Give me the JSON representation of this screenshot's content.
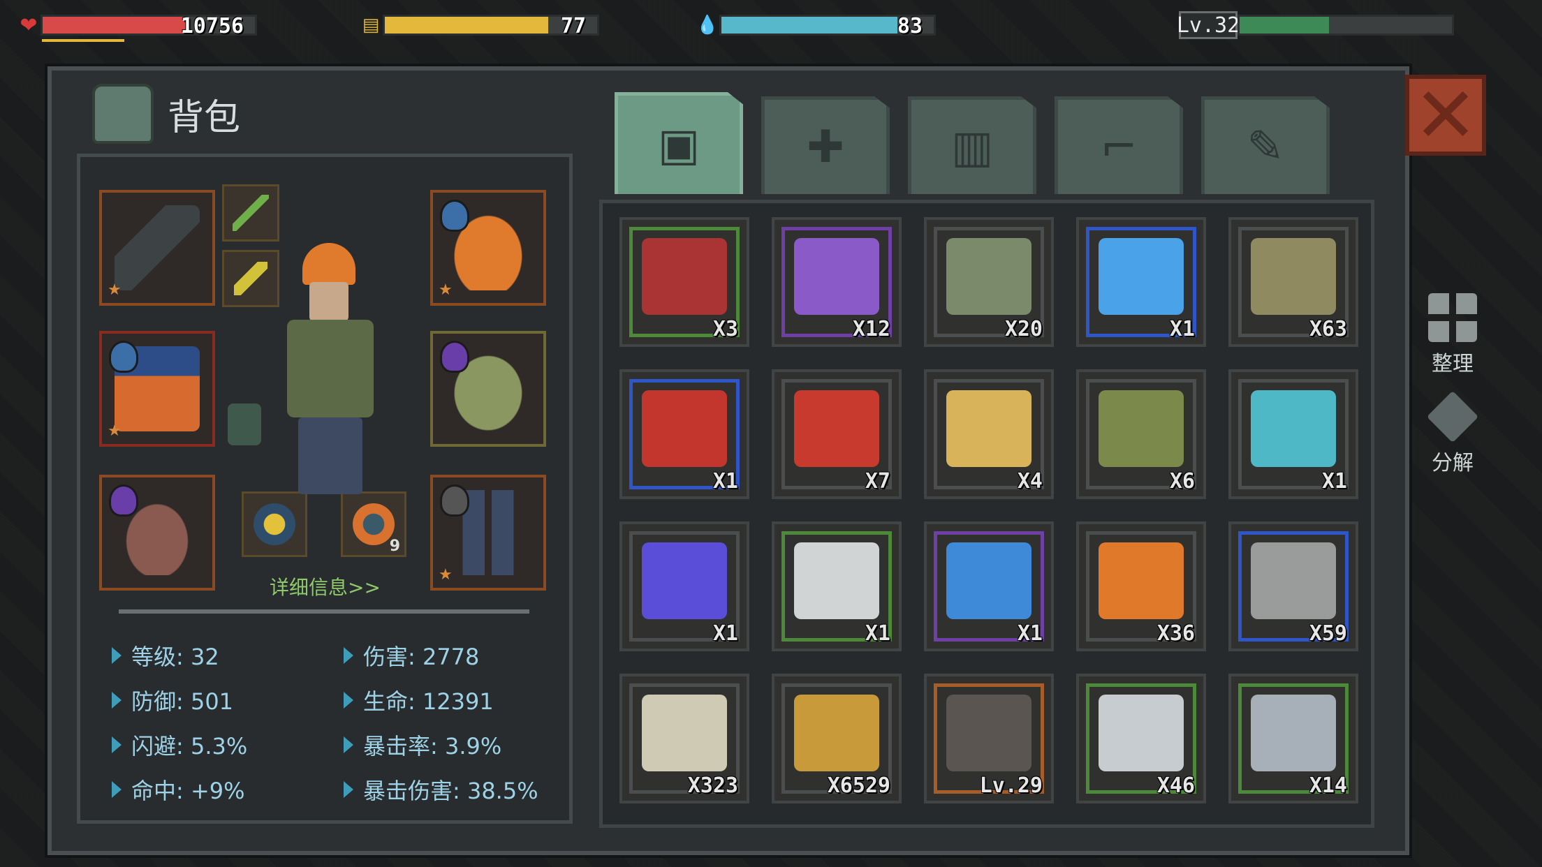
{
  "hud": {
    "hp": {
      "value": "10756",
      "fill": 0.68,
      "color": "#d84a4a"
    },
    "hunger": {
      "value": "77",
      "fill": 0.77,
      "color": "#e4b93b"
    },
    "water": {
      "value": "83",
      "fill": 0.83,
      "color": "#57b8cc"
    },
    "level": {
      "label": "Lv.32",
      "fill": 0.42,
      "color": "#3d8a57"
    }
  },
  "panel": {
    "title": "背包",
    "close_icon": "close-x-icon"
  },
  "tabs": [
    {
      "icon": "backpack-icon",
      "active": true
    },
    {
      "icon": "medkit-icon",
      "active": false
    },
    {
      "icon": "food-icon",
      "active": false
    },
    {
      "icon": "gun-icon",
      "active": false
    },
    {
      "icon": "tools-icon",
      "active": false
    }
  ],
  "equipment": {
    "detail_link": "详细信息>>",
    "small_slot_count": "9"
  },
  "stats": [
    {
      "label": "等级: 32"
    },
    {
      "label": "伤害: 2778"
    },
    {
      "label": "防御: 501"
    },
    {
      "label": "生命: 12391"
    },
    {
      "label": "闪避: 5.3%"
    },
    {
      "label": "暴击率: 3.9%"
    },
    {
      "label": "命中: +9%"
    },
    {
      "label": "暴击伤害: 38.5%"
    }
  ],
  "inventory": [
    {
      "name": "dynamite",
      "qty": "X3",
      "rarity": "green",
      "color": "#a33"
    },
    {
      "name": "purple-crate",
      "qty": "X12",
      "rarity": "purple",
      "color": "#8a5bc8"
    },
    {
      "name": "soup-can",
      "qty": "X20",
      "rarity": "gray",
      "color": "#7a8a6a"
    },
    {
      "name": "music-disc",
      "qty": "X1",
      "rarity": "blue",
      "color": "#4aa3e8"
    },
    {
      "name": "medic-bag",
      "qty": "X63",
      "rarity": "gray",
      "color": "#8f8a60"
    },
    {
      "name": "heart-monitor",
      "qty": "X1",
      "rarity": "blue",
      "color": "#c2362e"
    },
    {
      "name": "red-medkit",
      "qty": "X7",
      "rarity": "gray",
      "color": "#c83a2e"
    },
    {
      "name": "porridge-bowl",
      "qty": "X4",
      "rarity": "gray",
      "color": "#d9b35a"
    },
    {
      "name": "green-medkit",
      "qty": "X6",
      "rarity": "gray",
      "color": "#7b8a4a"
    },
    {
      "name": "cyan-device",
      "qty": "X1",
      "rarity": "gray",
      "color": "#4fb8c6"
    },
    {
      "name": "blue-chip-device",
      "qty": "X1",
      "rarity": "gray",
      "color": "#5a4ed8"
    },
    {
      "name": "download-device",
      "qty": "X1",
      "rarity": "green",
      "color": "#d0d4d4"
    },
    {
      "name": "blueprint-device",
      "qty": "X1",
      "rarity": "purple",
      "color": "#3f8ad8"
    },
    {
      "name": "carrot",
      "qty": "X36",
      "rarity": "gray",
      "color": "#e07a2a"
    },
    {
      "name": "microchip",
      "qty": "X59",
      "rarity": "blue",
      "color": "#9a9c9c"
    },
    {
      "name": "bandage",
      "qty": "X323",
      "rarity": "gray",
      "color": "#cfcab4"
    },
    {
      "name": "ammo-box",
      "qty": "X6529",
      "rarity": "gray",
      "color": "#c89a3a"
    },
    {
      "name": "crossbow",
      "qty": "Lv.29",
      "rarity": "orange",
      "color": "#5a5550"
    },
    {
      "name": "iron-ore",
      "qty": "X46",
      "rarity": "green",
      "color": "#c6ccd0"
    },
    {
      "name": "metal-plate",
      "qty": "X14",
      "rarity": "green",
      "color": "#a7b0b8"
    }
  ],
  "side_buttons": [
    {
      "label": "整理",
      "icon": "sort-grid-icon"
    },
    {
      "label": "分解",
      "icon": "dismantle-icon"
    }
  ]
}
